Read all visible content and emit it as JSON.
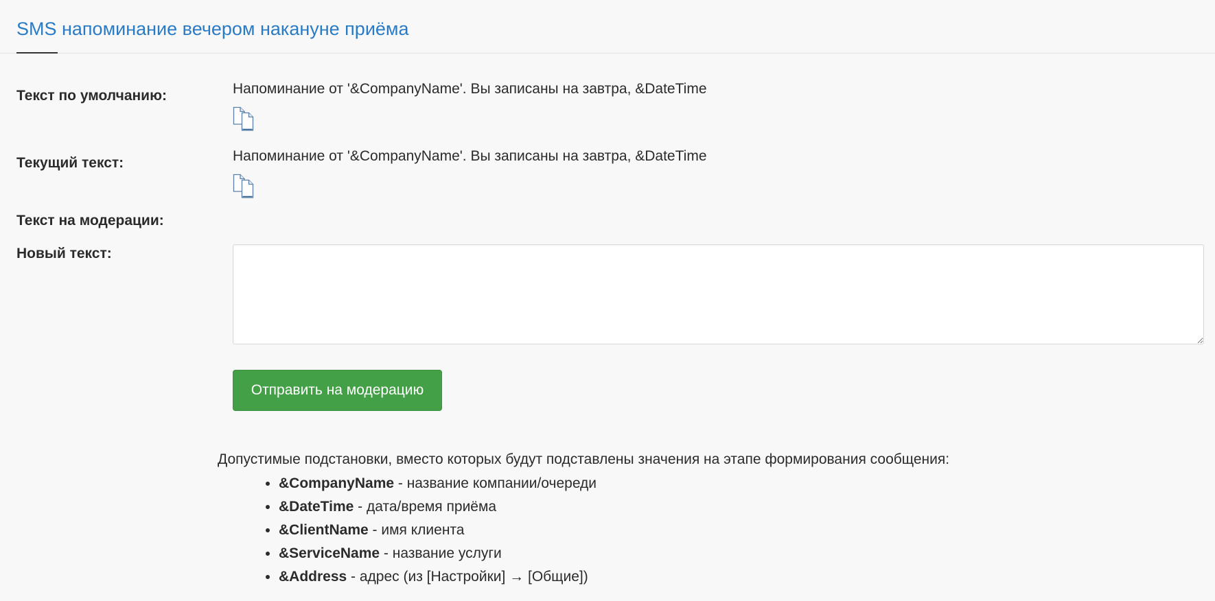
{
  "section": {
    "title": "SMS напоминание вечером накануне приёма"
  },
  "fields": {
    "default_label": "Текст по умолчанию:",
    "default_value": "Напоминание от '&CompanyName'. Вы записаны на завтра, &DateTime",
    "current_label": "Текущий текст:",
    "current_value": "Напоминание от '&CompanyName'. Вы записаны на завтра, &DateTime",
    "moderation_label": "Текст на модерации:",
    "new_label": "Новый текст:",
    "new_value": ""
  },
  "actions": {
    "submit_label": "Отправить на модерацию"
  },
  "substitutions": {
    "intro": "Допустимые подстановки, вместо которых будут подставлены значения на этапе формирования сообщения:",
    "items": [
      {
        "key": "&CompanyName",
        "desc": " - название компании/очереди"
      },
      {
        "key": "&DateTime",
        "desc": " - дата/время приёма"
      },
      {
        "key": "&ClientName",
        "desc": " - имя клиента"
      },
      {
        "key": "&ServiceName",
        "desc": " - название услуги"
      },
      {
        "key": "&Address",
        "desc": " - адрес (из [Настройки] → [Общие])"
      }
    ]
  },
  "colors": {
    "title": "#2a7bc6",
    "button": "#43a047",
    "background": "#f8f8f8"
  },
  "icons": {
    "copy": "copy-documents-icon"
  }
}
